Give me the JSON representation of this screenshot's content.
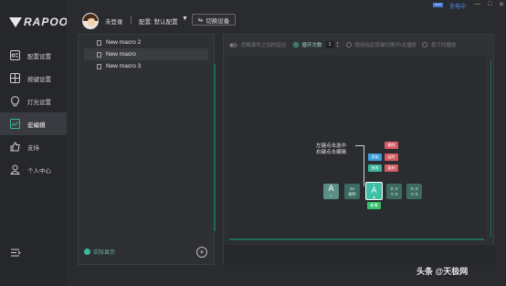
{
  "brand": {
    "logo_text": "RAPOO"
  },
  "sidebar": {
    "items": [
      {
        "label": "配置设置",
        "icon": "profile-settings-icon"
      },
      {
        "label": "按键设置",
        "icon": "key-grid-icon"
      },
      {
        "label": "灯光设置",
        "icon": "lightbulb-icon"
      },
      {
        "label": "宏编辑",
        "icon": "macro-edit-icon",
        "active": true
      },
      {
        "label": "支持",
        "icon": "thumbs-up-icon"
      },
      {
        "label": "个人中心",
        "icon": "user-icon"
      }
    ],
    "expand_icon": "expand-menu-icon"
  },
  "header": {
    "user": "未登录",
    "profile": "配置: 默认配置",
    "switch_device": "切换设备",
    "battery_label": "100%",
    "charging": "充电中",
    "window_controls": [
      "—",
      "□",
      "✕"
    ]
  },
  "macros": {
    "items": [
      "New macro 2",
      "New macro",
      "New macro 3"
    ],
    "highlighted": 1,
    "record_label": "实际显示",
    "add_symbol": "+"
  },
  "options": {
    "ignore_delay": "忽略事件之间的延迟",
    "loop_count_label": "循环次数",
    "loop_count": "1",
    "use_button_toggle": "使用指定按键切换开/关播放",
    "hold_to_play": "按下时播放"
  },
  "editor": {
    "hint_line1": "左键点击选中",
    "hint_line2": "右键点击编辑",
    "nodes": {
      "key1": {
        "letter": "A",
        "sub": "•"
      },
      "delay": {
        "value": "34",
        "unit": "毫秒"
      },
      "key2": {
        "top": "•",
        "letter": "A",
        "sub": "▲"
      },
      "xy1": {
        "x": "X: 0",
        "y": "Y: 0"
      },
      "xy2": {
        "x": "X: 0",
        "y": "Y: 0"
      }
    },
    "menu": {
      "delete": "删除",
      "add": "添加",
      "add_after": "延时",
      "modify": "修改",
      "copy": "复制",
      "insert": "新增"
    }
  },
  "watermark": "头条 @天极网",
  "colors": {
    "accent": "#38b99b",
    "danger": "#d65a63",
    "info": "#3e9edc",
    "charging": "#4b8ff0"
  }
}
